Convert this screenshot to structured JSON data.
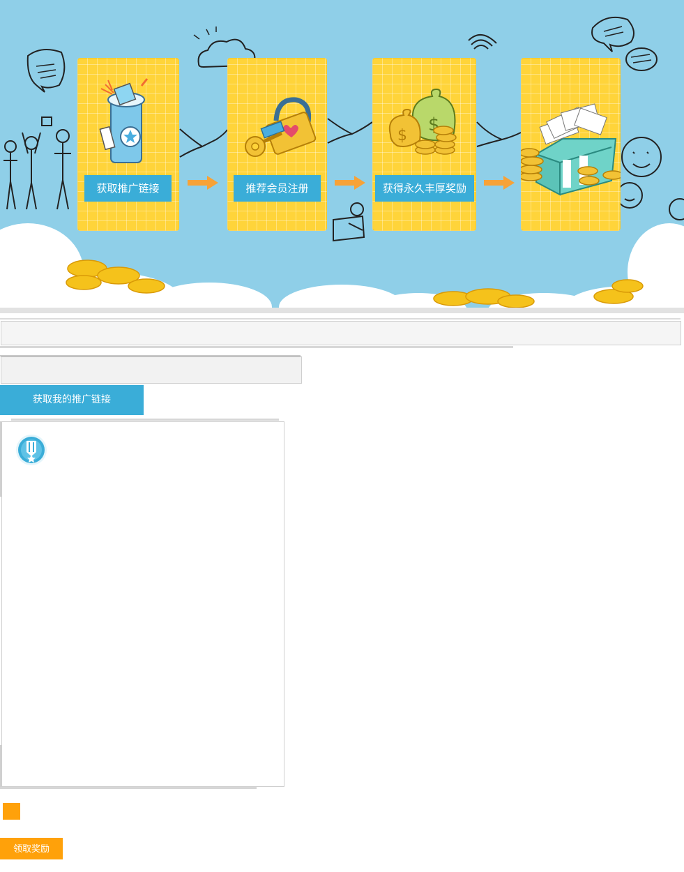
{
  "banner": {
    "steps": [
      {
        "label": "获取推广链接",
        "icon": "cup-icon"
      },
      {
        "label": "推荐会员注册",
        "icon": "lock-key-icon"
      },
      {
        "label": "获得永久丰厚奖励",
        "icon": "money-bag-icon"
      },
      {
        "label": "",
        "icon": "gift-box-money-icon"
      }
    ],
    "colors": {
      "sky": "#8fcfe8",
      "card": "#ffd43a",
      "label": "#3aadd8",
      "arrow": "#f7a237"
    }
  },
  "form": {
    "get_link_button": "获取我的推广链接",
    "claim_button": "领取奖励",
    "colors": {
      "primary": "#3aadd8",
      "accent": "#ffa10a"
    }
  }
}
